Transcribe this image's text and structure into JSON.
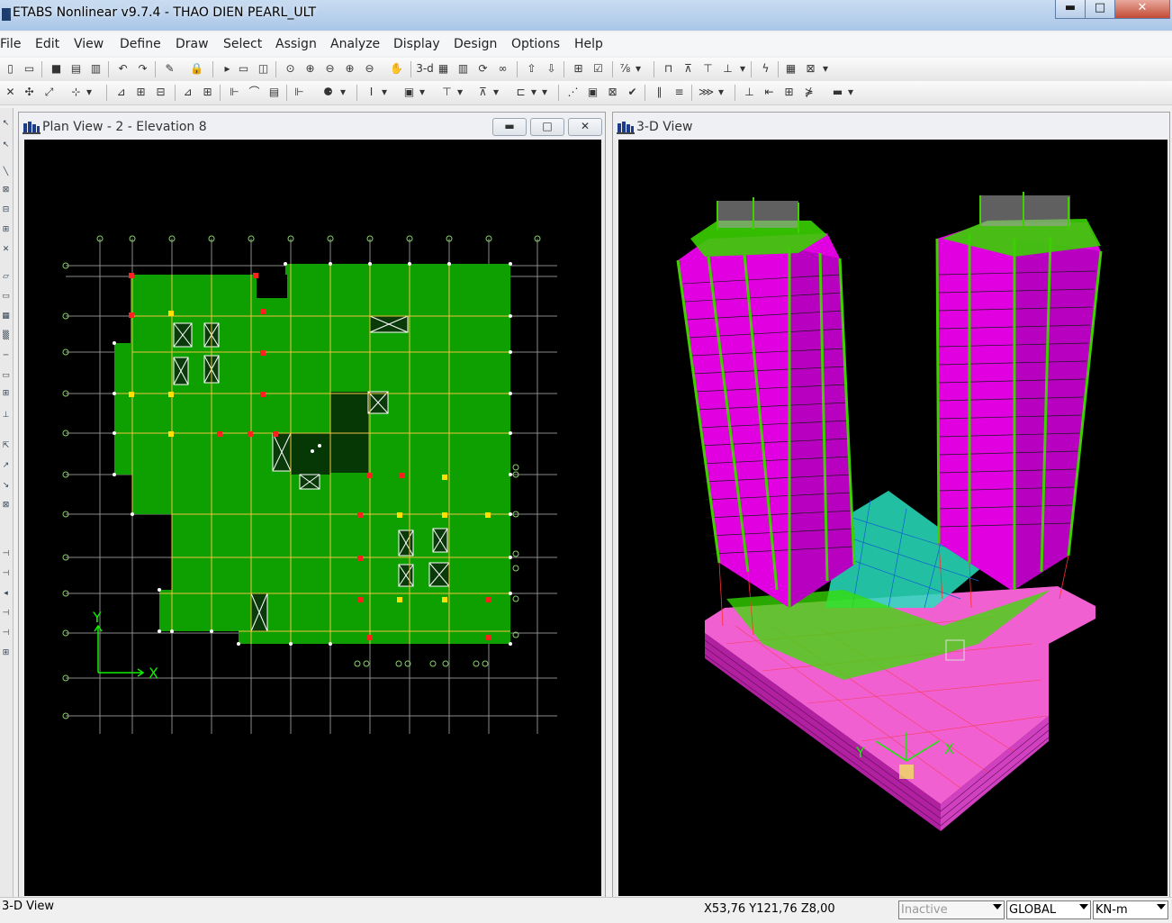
{
  "window": {
    "title": "ETABS Nonlinear v9.7.4 - THAO DIEN PEARL_ULT",
    "minimize_glyph": "▬",
    "maximize_glyph": "□",
    "close_glyph": "✕"
  },
  "menu": [
    "File",
    "Edit",
    "View",
    "Define",
    "Draw",
    "Select",
    "Assign",
    "Analyze",
    "Display",
    "Design",
    "Options",
    "Help"
  ],
  "toolbar_row1_labels": [
    "3-d",
    "Plan",
    "Elev"
  ],
  "toolbar_row1_icons": [
    "new-file",
    "open-file",
    "save",
    "print-graphics",
    "print-tables",
    "undo",
    "redo",
    "refresh",
    "lock",
    "run-analysis",
    "run-pause",
    "rubber-band-zoom",
    "restore-zoom",
    "zoom-in",
    "zoom-out",
    "pan",
    "view-3d",
    "view-plan",
    "view-elevation",
    "rotate-3d",
    "perspective",
    "move-up",
    "move-down",
    "display-options",
    "set-building-view",
    "shadow",
    "object-shrink",
    "extrude",
    "show-undeformed",
    "show-deformed",
    "show-forces",
    "animation",
    "show-tables",
    "show-reactions"
  ],
  "toolbar_row2_icons": [
    "pointer",
    "reshape",
    "snap",
    "select-all",
    "draw-line",
    "draw-frame",
    "draw-area",
    "draw-wall",
    "draw-point",
    "quick-draw",
    "section-cut",
    "dimension",
    "link",
    "spring",
    "point-load",
    "frame-load",
    "area-load",
    "assign-restraint",
    "assign-diaphragm",
    "pier-label",
    "spandrel-label",
    "design-check",
    "design-steel",
    "design-concrete",
    "design-composite",
    "display-design"
  ],
  "plan_view": {
    "title": "Plan View - 2 - Elevation 8",
    "axis_x": "X",
    "axis_y": "Y",
    "min_glyph": "▬",
    "max_glyph": "□",
    "close_glyph": "✕"
  },
  "view_3d": {
    "title": "3-D View",
    "axis_x": "X",
    "axis_y": "Y"
  },
  "status": {
    "left": "3-D View",
    "coords": "X53,76  Y121,76  Z8,00",
    "mode_select": "Inactive",
    "coord_system": "GLOBAL",
    "units": "KN-m"
  },
  "colors": {
    "plan_slab": "#0ea000",
    "grid_line": "#8a8a8a",
    "beam": "#f0c040",
    "column_red": "#ff2020",
    "core_fill": "#0a3a0a",
    "tower_magenta": "#e000e0",
    "podium_pink": "#f060d0",
    "podium_cyan": "#28e0c0"
  }
}
